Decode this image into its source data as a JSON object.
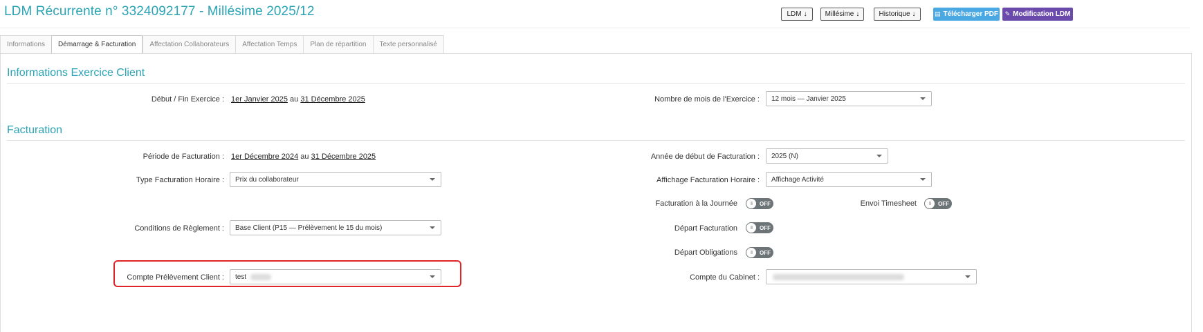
{
  "header": {
    "title": "LDM Récurrente n° 3324092177 - Millésime 2025/12",
    "buttons": {
      "ldm": "LDM",
      "millesime": "Millésime",
      "historique": "Historique",
      "caret": "↓",
      "pdf": "Télécharger PDF",
      "modification": "Modification LDM"
    }
  },
  "tabs": [
    {
      "label": "Informations",
      "active": false
    },
    {
      "label": "Démarrage & Facturation",
      "active": true
    },
    {
      "label": "Affectation Collaborateurs",
      "active": false
    },
    {
      "label": "Affectation Temps",
      "active": false
    },
    {
      "label": "Plan de répartition",
      "active": false
    },
    {
      "label": "Texte personnalisé",
      "active": false
    }
  ],
  "exercice": {
    "title": "Informations Exercice Client",
    "debut_fin_label": "Début / Fin Exercice :",
    "debut": "1er Janvier 2025",
    "joiner": "au",
    "fin": "31 Décembre 2025",
    "nb_mois_label": "Nombre de mois de l'Exercice :",
    "nb_mois_value": "12 mois — Janvier 2025"
  },
  "facturation": {
    "title": "Facturation",
    "periode_label": "Période de Facturation :",
    "periode_debut": "1er Décembre 2024",
    "periode_joiner": "au",
    "periode_fin": "31 Décembre 2025",
    "annee_label": "Année de début de Facturation :",
    "annee_value": "2025 (N)",
    "type_horaire_label": "Type Facturation Horaire :",
    "type_horaire_value": "Prix du collaborateur",
    "affichage_label": "Affichage Facturation Horaire :",
    "affichage_value": "Affichage Activité",
    "journee_label": "Facturation à la Journée",
    "timesheet_label": "Envoi Timesheet",
    "conditions_label": "Conditions de Règlement :",
    "conditions_value": "Base Client (P15 — Prélèvement le 15 du mois)",
    "depart_fact_label": "Départ Facturation",
    "depart_oblig_label": "Départ Obligations",
    "compte_prelev_label": "Compte Prélèvement Client :",
    "compte_prelev_value": "test",
    "compte_cabinet_label": "Compte du Cabinet :",
    "toggle_off": "OFF",
    "toggle_knob": "III"
  },
  "colors": {
    "accent": "#2aa3b5",
    "pdf_button": "#4aa8e3",
    "modification_button": "#6a4bab",
    "toggle_off": "#6d7478",
    "highlight": "#e0252a"
  }
}
